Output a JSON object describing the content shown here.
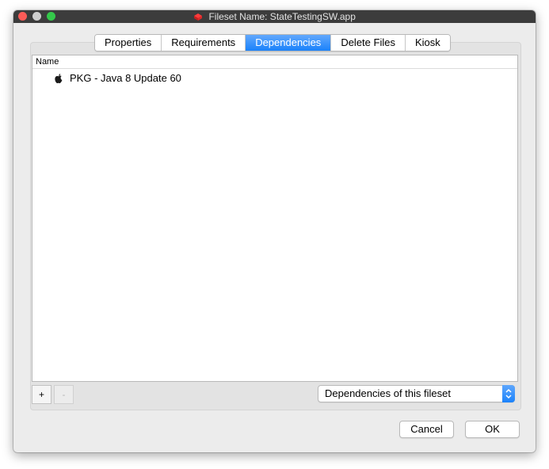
{
  "window": {
    "title": "Fileset Name: StateTestingSW.app"
  },
  "tabs": [
    {
      "label": "Properties",
      "active": false
    },
    {
      "label": "Requirements",
      "active": false
    },
    {
      "label": "Dependencies",
      "active": true
    },
    {
      "label": "Delete Files",
      "active": false
    },
    {
      "label": "Kiosk",
      "active": false
    }
  ],
  "list": {
    "column_header": "Name",
    "rows": [
      {
        "icon": "apple-icon",
        "label": "PKG - Java 8 Update 60"
      }
    ]
  },
  "toolbar": {
    "add_label": "+",
    "remove_label": "-"
  },
  "filter_popup": {
    "selected": "Dependencies of this fileset"
  },
  "buttons": {
    "cancel": "Cancel",
    "ok": "OK"
  },
  "colors": {
    "accent": "#1a82fb",
    "close": "#fc5b57",
    "maximize": "#34c84a",
    "titlebar": "#3c3c3c"
  }
}
